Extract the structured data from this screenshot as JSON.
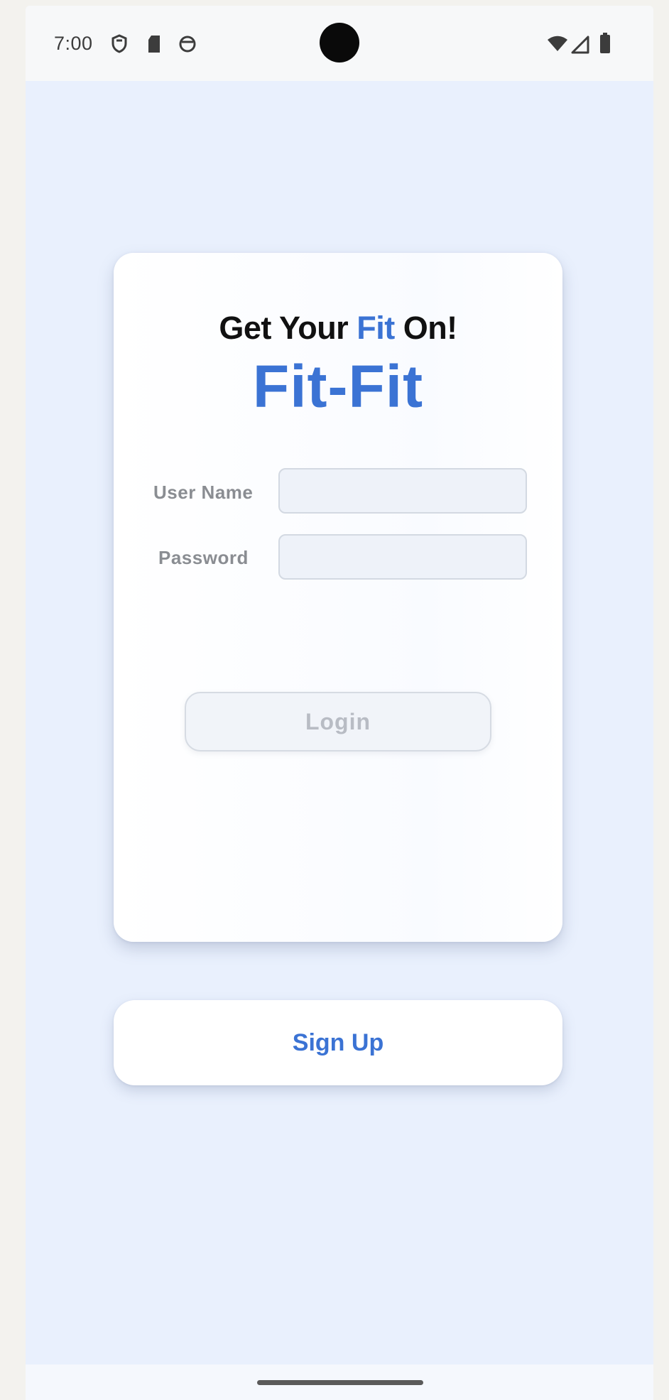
{
  "status_bar": {
    "time": "7:00",
    "left_icons": [
      "shield-icon",
      "sd-card-icon",
      "notification-icon"
    ],
    "right_icons": [
      "wifi-icon",
      "cell-signal-icon",
      "battery-icon"
    ]
  },
  "card": {
    "tagline_prefix": "Get Your ",
    "tagline_highlight": "Fit",
    "tagline_suffix": " On!",
    "brand": "Fit-Fit",
    "username_label": "User Name",
    "username_value": "",
    "password_label": "Password",
    "password_value": "",
    "login_label": "Login"
  },
  "signup": {
    "label": "Sign Up"
  },
  "colors": {
    "accent": "#3b73d4",
    "background": "#e9f0fd",
    "card": "#ffffff"
  }
}
